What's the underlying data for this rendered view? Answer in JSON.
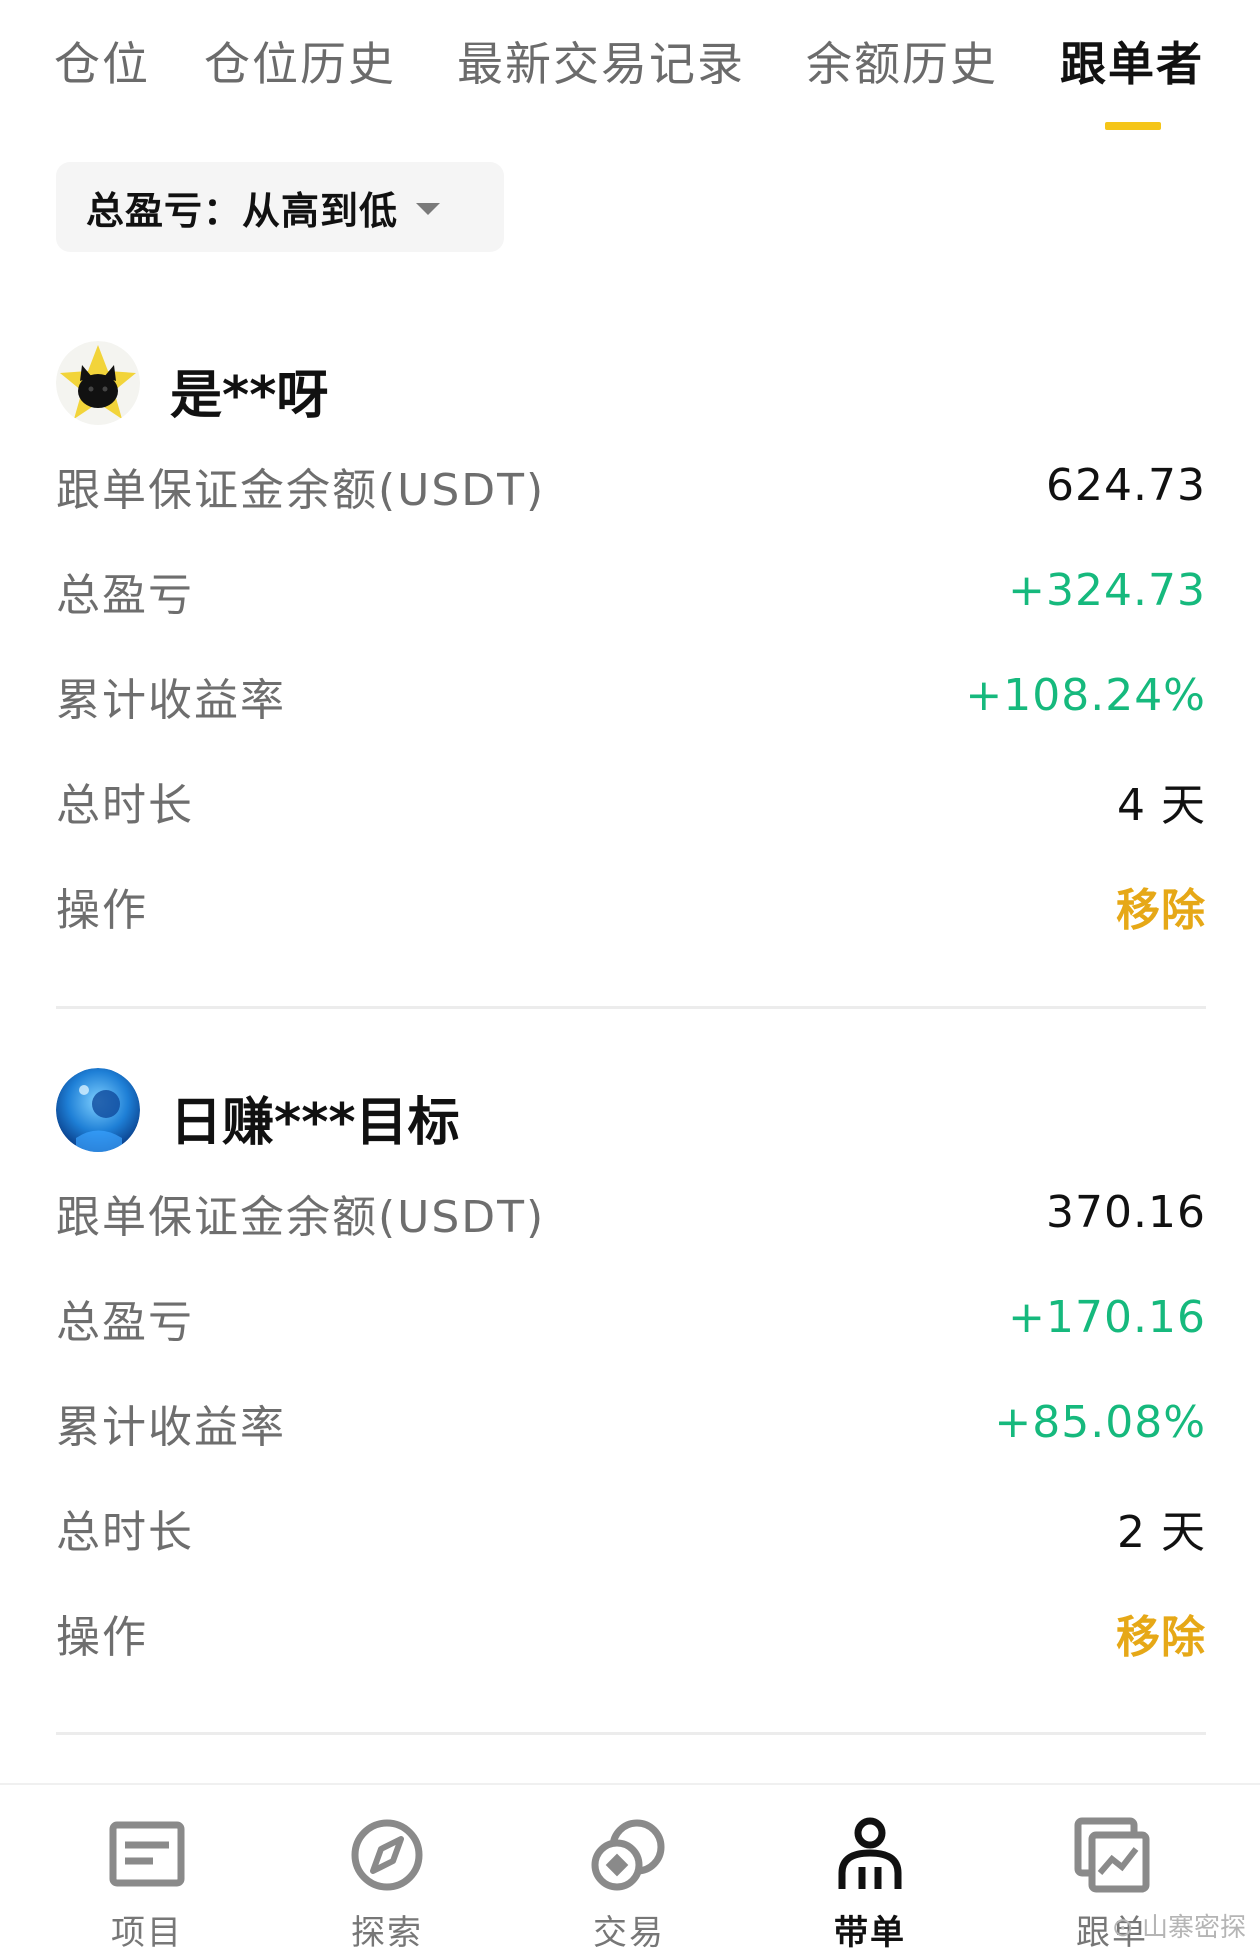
{
  "tabs": [
    {
      "label": "仓位"
    },
    {
      "label": "仓位历史"
    },
    {
      "label": "最新交易记录"
    },
    {
      "label": "余额历史"
    },
    {
      "label": "跟单者",
      "active": true
    }
  ],
  "colors": {
    "accent": "#f5c518",
    "green": "#16b97d",
    "action": "#e6a817"
  },
  "sort": {
    "label": "总盈亏：从高到低",
    "icon": "caret-down-icon"
  },
  "followers": [
    {
      "nickname": "是**呀",
      "avatar_icon": "black-cat-star-avatar",
      "rows": [
        {
          "label": "跟单保证金余额(USDT)",
          "value": "624.73"
        },
        {
          "label": "总盈亏",
          "value": "+324.73"
        },
        {
          "label": "累计收益率",
          "value": "+108.24%"
        },
        {
          "label": "总时长",
          "value": "4 天"
        },
        {
          "label": "操作",
          "value": "移除"
        }
      ]
    },
    {
      "nickname": "日赚***目标",
      "avatar_icon": "blue-ocean-avatar",
      "rows": [
        {
          "label": "跟单保证金余额(USDT)",
          "value": "370.16"
        },
        {
          "label": "总盈亏",
          "value": "+170.16"
        },
        {
          "label": "累计收益率",
          "value": "+85.08%"
        },
        {
          "label": "总时长",
          "value": "2 天"
        },
        {
          "label": "操作",
          "value": "移除"
        }
      ]
    }
  ],
  "bottom_nav": [
    {
      "label": "项目",
      "icon": "list-icon"
    },
    {
      "label": "探索",
      "icon": "compass-icon"
    },
    {
      "label": "交易",
      "icon": "exchange-icon"
    },
    {
      "label": "带单",
      "icon": "person-icon",
      "active": true
    },
    {
      "label": "跟单",
      "icon": "chart-copy-icon"
    }
  ],
  "watermark": "山寨密探"
}
